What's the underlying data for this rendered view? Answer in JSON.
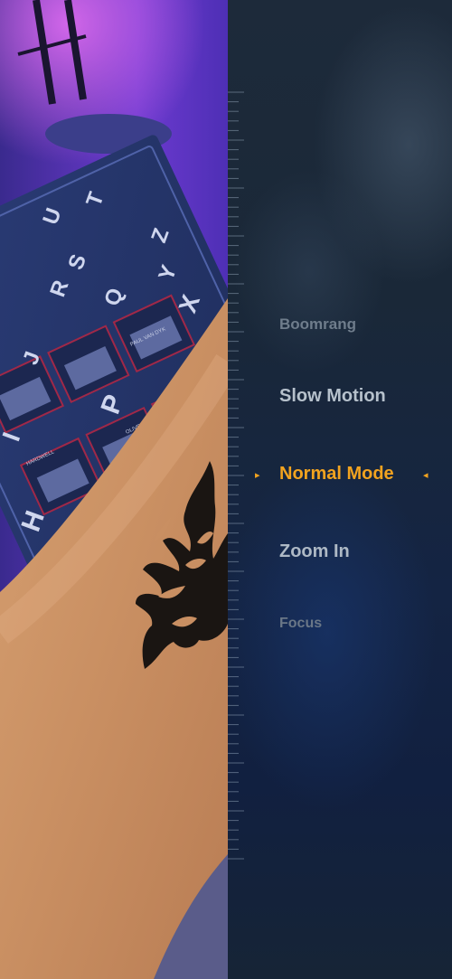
{
  "camera": {
    "board_letters": [
      "T",
      "U",
      "Z",
      "S",
      "R",
      "Q",
      "X",
      "Y",
      "I",
      "J",
      "P",
      "H"
    ],
    "board_labels": [
      "HARDWELL",
      "OLIVER",
      "PAUL VAN DYK"
    ]
  },
  "modes": {
    "items": [
      {
        "label": "Boomrang"
      },
      {
        "label": "Slow Motion"
      },
      {
        "label": "Normal Mode"
      },
      {
        "label": "Zoom In"
      },
      {
        "label": "Focus"
      }
    ],
    "selected_index": 2,
    "selected_color": "#f2a31f",
    "marker_left": "▸",
    "marker_right": "◂"
  }
}
